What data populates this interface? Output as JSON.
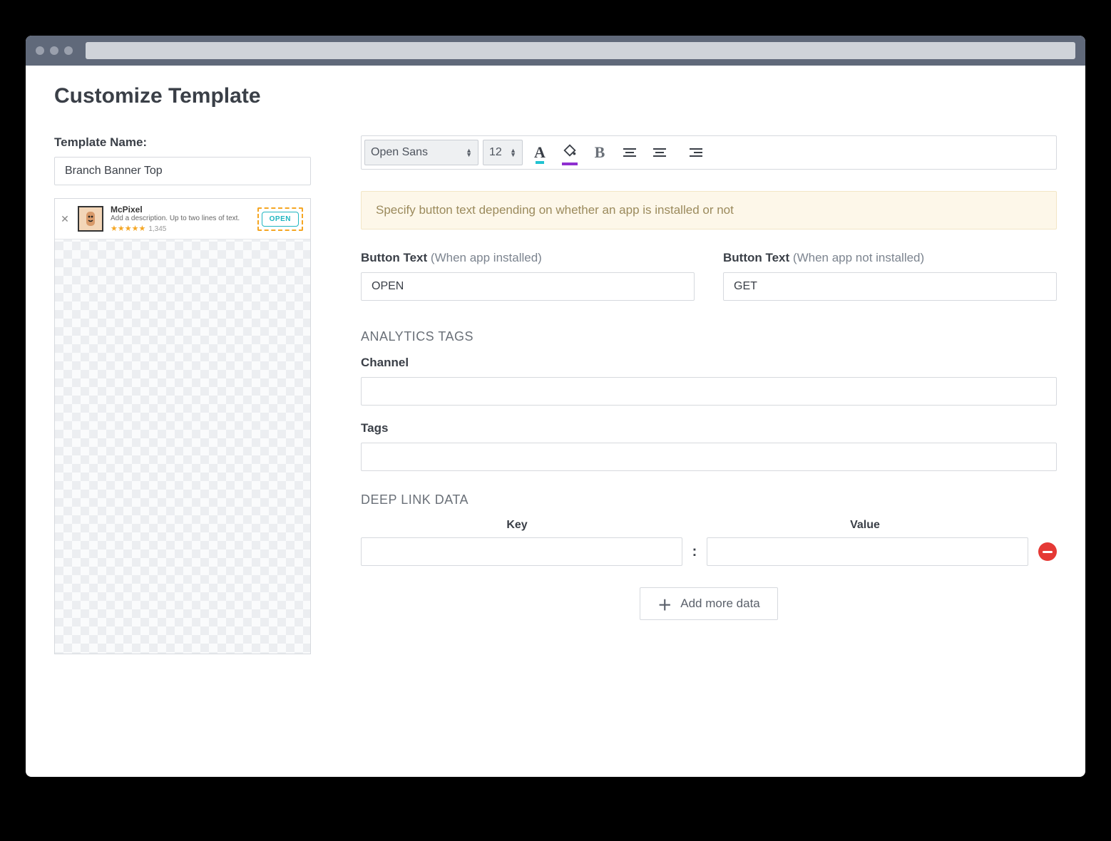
{
  "page": {
    "title": "Customize Template"
  },
  "template": {
    "name_label": "Template Name:",
    "name_value": "Branch Banner Top"
  },
  "preview_banner": {
    "app_name": "McPixel",
    "description": "Add a description. Up to two lines of text.",
    "rating_count": "1,345",
    "cta": "OPEN"
  },
  "toolbar": {
    "font": "Open Sans",
    "size": "12"
  },
  "info_text": "Specify button text depending on whether an app is installed or not",
  "button_text": {
    "installed_label": "Button Text",
    "installed_sub": "(When app installed)",
    "installed_value": "OPEN",
    "not_installed_label": "Button Text",
    "not_installed_sub": "(When app not installed)",
    "not_installed_value": "GET"
  },
  "analytics": {
    "heading": "ANALYTICS TAGS",
    "channel_label": "Channel",
    "channel_value": "",
    "tags_label": "Tags",
    "tags_value": ""
  },
  "deeplink": {
    "heading": "DEEP LINK DATA",
    "key_header": "Key",
    "value_header": "Value",
    "rows": [
      {
        "key": "",
        "value": ""
      }
    ],
    "add_label": "Add more data"
  }
}
